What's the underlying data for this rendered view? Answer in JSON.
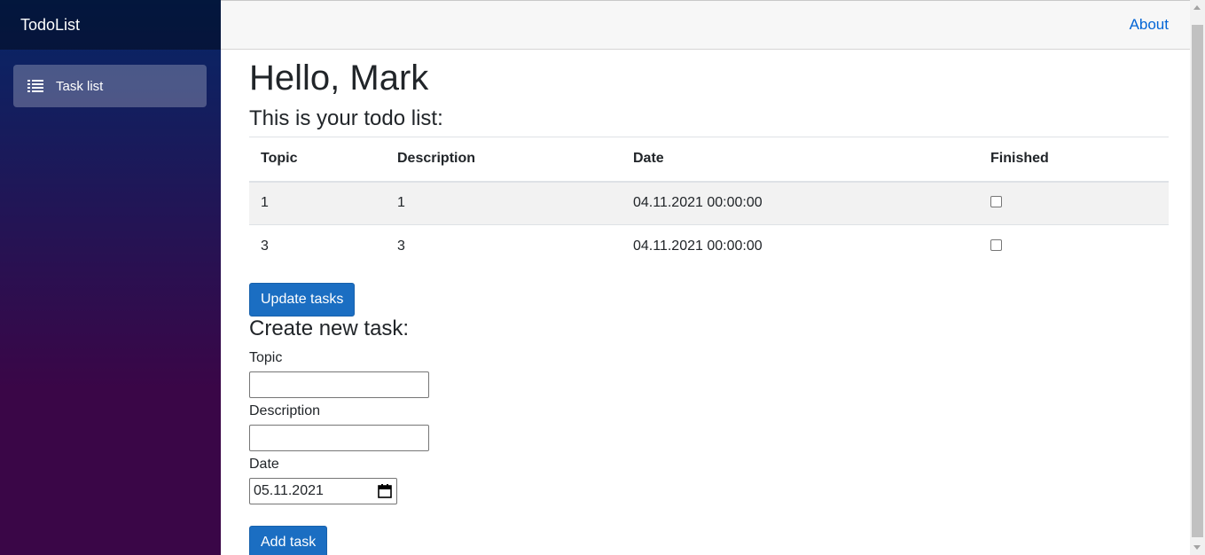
{
  "app": {
    "brand": "TodoList"
  },
  "sidebar": {
    "items": [
      {
        "label": "Task list",
        "icon": "list-icon"
      }
    ]
  },
  "top_row": {
    "about_label": "About"
  },
  "main": {
    "greeting": "Hello, Mark",
    "subtitle": "This is your todo list:",
    "table": {
      "columns": [
        "Topic",
        "Description",
        "Date",
        "Finished"
      ],
      "rows": [
        {
          "topic": "1",
          "description": "1",
          "date": "04.11.2021 00:00:00",
          "finished": false
        },
        {
          "topic": "3",
          "description": "3",
          "date": "04.11.2021 00:00:00",
          "finished": false
        }
      ]
    },
    "update_button": "Update tasks",
    "create_title": "Create new task:",
    "form": {
      "topic_label": "Topic",
      "topic_value": "",
      "description_label": "Description",
      "description_value": "",
      "date_label": "Date",
      "date_value": "05.11.2021"
    },
    "add_button": "Add task"
  },
  "colors": {
    "sidebar_gradient_top": "#052767",
    "sidebar_gradient_bottom": "#3a0647",
    "button_primary": "#1b6ec2",
    "link": "#0366d6"
  }
}
